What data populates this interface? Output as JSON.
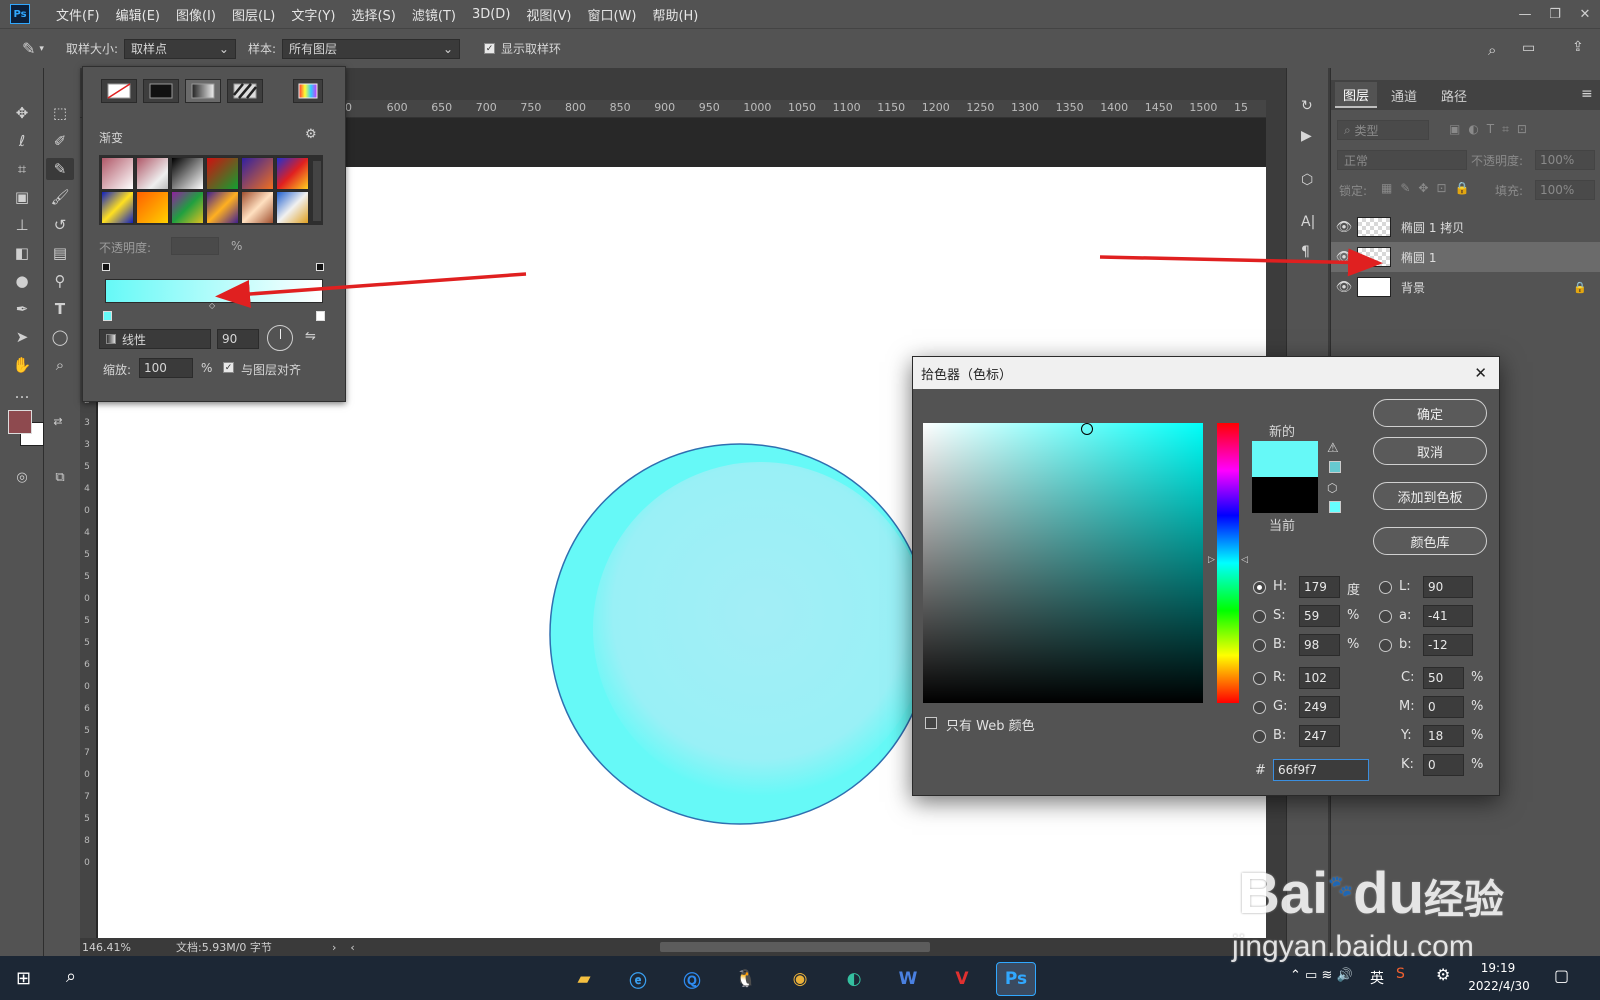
{
  "app": {
    "logo": "Ps",
    "menu": [
      "文件(F)",
      "编辑(E)",
      "图像(I)",
      "图层(L)",
      "文字(Y)",
      "选择(S)",
      "滤镜(T)",
      "3D(D)",
      "视图(V)",
      "窗口(W)",
      "帮助(H)"
    ],
    "window_controls": [
      "—",
      "❐",
      "✕"
    ]
  },
  "options_bar": {
    "sample_size_label": "取样大小:",
    "sample_size_value": "取样点",
    "sample_label": "样本:",
    "sample_value": "所有图层",
    "show_ring_label": "显示取样环"
  },
  "ruler": {
    "h_ticks": [
      "00",
      "600",
      "650",
      "700",
      "750",
      "800",
      "850",
      "900",
      "950",
      "1000",
      "1050",
      "1100",
      "1150",
      "1200",
      "1250",
      "1300",
      "1350",
      "1400",
      "1450",
      "1500",
      "15"
    ],
    "v_ticks": [
      "2",
      "3",
      "3",
      "5",
      "4",
      "0",
      "4",
      "5",
      "5",
      "0",
      "5",
      "5",
      "6",
      "0",
      "6",
      "5",
      "7",
      "0",
      "7",
      "5",
      "8",
      "0"
    ]
  },
  "status": {
    "zoom": "146.41%",
    "doc": "文档:5.93M/0 字节"
  },
  "gradient_panel": {
    "section_label": "渐变",
    "opacity_label": "不透明度:",
    "opacity_unit": "%",
    "type_value": "线性",
    "angle_value": "90",
    "scale_label": "缩放:",
    "scale_value": "100",
    "scale_unit": "%",
    "align_label": "与图层对齐",
    "stop_color": "#66f9f7"
  },
  "layers_panel": {
    "tabs": [
      "图层",
      "通道",
      "路径"
    ],
    "filter_label": "类型",
    "blend_mode": "正常",
    "opacity_label": "不透明度:",
    "opacity_value": "100%",
    "lock_label": "锁定:",
    "fill_label": "填充:",
    "fill_value": "100%",
    "layers": [
      {
        "name": "椭圆 1 拷贝",
        "selected": false
      },
      {
        "name": "椭圆 1",
        "selected": true
      },
      {
        "name": "背景",
        "selected": false
      }
    ]
  },
  "color_picker": {
    "title": "拾色器（色标）",
    "new_label": "新的",
    "current_label": "当前",
    "buttons": {
      "ok": "确定",
      "cancel": "取消",
      "add_swatch": "添加到色板",
      "libraries": "颜色库"
    },
    "web_only_label": "只有 Web 颜色",
    "new_color": "#66f9f7",
    "current_color": "#000000",
    "fields": {
      "H": "179",
      "S": "59",
      "B": "98",
      "R": "102",
      "G": "249",
      "B2": "247",
      "L": "90",
      "a": "-41",
      "b": "-12",
      "C": "50",
      "M": "0",
      "Y": "18",
      "K": "0",
      "hex": "66f9f7"
    },
    "units": {
      "deg": "度",
      "pct": "%"
    },
    "labels": {
      "H": "H:",
      "S": "S:",
      "B": "B:",
      "R": "R:",
      "G": "G:",
      "B2": "B:",
      "L": "L:",
      "a": "a:",
      "b": "b:",
      "C": "C:",
      "M": "M:",
      "Y": "Y:",
      "K": "K:",
      "hex": "#"
    }
  },
  "taskbar": {
    "time": "19:19",
    "date": "2022/4/30",
    "ime": "英"
  },
  "watermark": {
    "brand": "Bai",
    "brand2": "du",
    "cn": "经验",
    "url": "jingyan.baidu.com"
  },
  "colors": {
    "accent_red": "#e02020",
    "foreground_swatch": "#8e4a4f",
    "circle_fill": "#9ff2f7",
    "circle_edge": "#2f6fb0"
  }
}
